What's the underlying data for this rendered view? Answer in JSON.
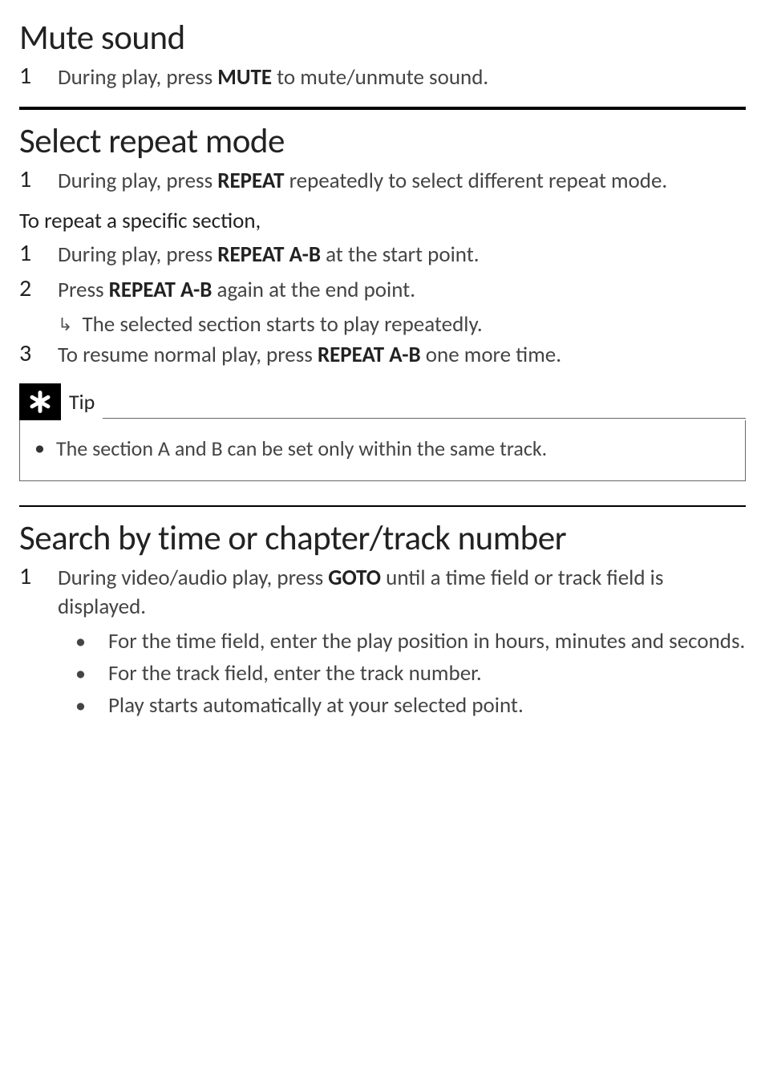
{
  "mute": {
    "heading": "Mute sound",
    "step1_prefix": "During play, press ",
    "step1_bold": "MUTE",
    "step1_suffix": " to mute/unmute sound."
  },
  "repeat": {
    "heading": "Select repeat mode",
    "step1_prefix": "During play, press ",
    "step1_bold": "REPEAT",
    "step1_suffix": " repeatedly to select different repeat mode.",
    "subheading": "To repeat a specific section,",
    "sec_step1_prefix": "During play, press ",
    "sec_step1_bold": "REPEAT A-B",
    "sec_step1_suffix": " at the start point.",
    "sec_step2_prefix": "Press ",
    "sec_step2_bold": "REPEAT A-B",
    "sec_step2_suffix": " again at the end point.",
    "sec_step2_result": "The selected section starts to play repeatedly.",
    "sec_step3_prefix": "To resume normal play, press ",
    "sec_step3_bold": "REPEAT A-B",
    "sec_step3_suffix": " one more time.",
    "tip_label": "Tip",
    "tip_text": "The section A and B can be set only within the same track."
  },
  "search": {
    "heading": "Search by time or chapter/track number",
    "step1_prefix": "During video/audio play, press ",
    "step1_bold": "GOTO",
    "step1_suffix": " until a time field or track field is displayed.",
    "bullet1": "For the time field, enter the play position in hours, minutes and seconds.",
    "bullet2": "For the track field, enter the track number.",
    "bullet3": "Play starts automatically at your selected point."
  },
  "numbers": {
    "n1": "1",
    "n2": "2",
    "n3": "3"
  }
}
